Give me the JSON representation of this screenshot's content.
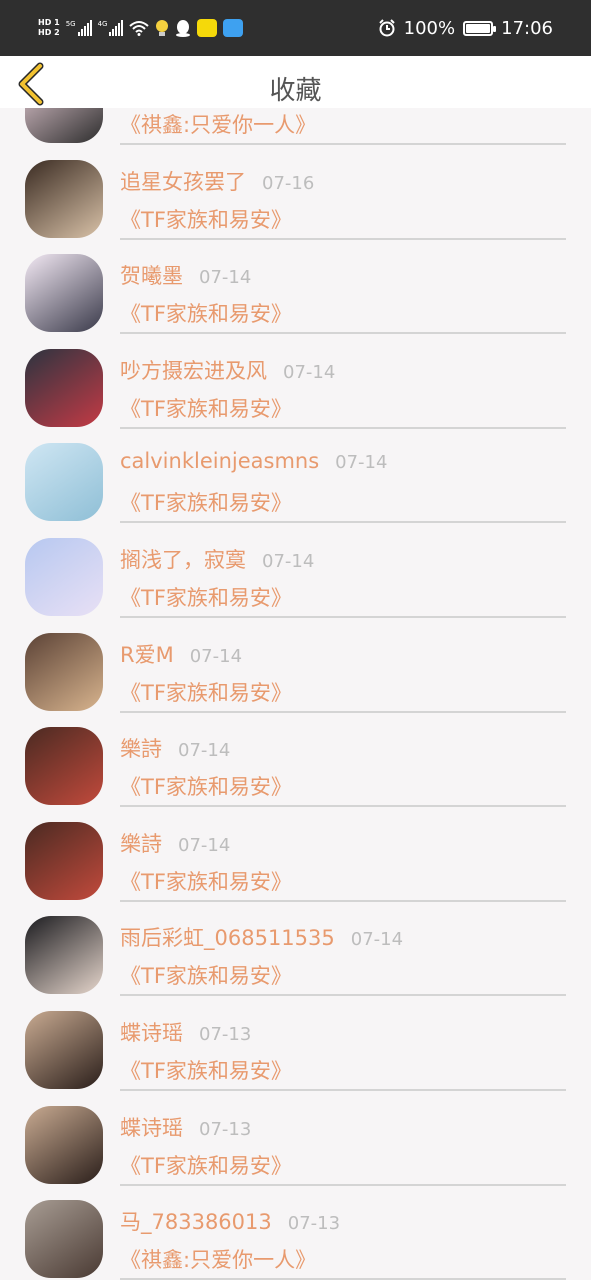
{
  "status_bar": {
    "hd1": "HD 1",
    "hd2": "HD 2",
    "sig1_tag": "5G",
    "sig2_tag": "4G",
    "battery": "100%",
    "time": "17:06"
  },
  "header": {
    "title": "收藏"
  },
  "colors": {
    "accent": "#e89a6e",
    "muted": "#bdbdbd",
    "status_bar": "#2f2f2f",
    "back": "#f2c230"
  },
  "items": [
    {
      "name": "",
      "date": "",
      "group": "《祺鑫:只爱你一人》",
      "avatar": [
        "#f1d6df",
        "#2d2d2d"
      ]
    },
    {
      "name": "追星女孩罢了",
      "date": "07-16",
      "group": "《TF家族和易安》",
      "avatar": [
        "#3a2b22",
        "#d9c2a8"
      ]
    },
    {
      "name": "贺曦墨",
      "date": "07-14",
      "group": "《TF家族和易安》",
      "avatar": [
        "#f3e9f4",
        "#3a3a4a"
      ]
    },
    {
      "name": "吵方摄宏进及风",
      "date": "07-14",
      "group": "《TF家族和易安》",
      "avatar": [
        "#2c3440",
        "#c43a45"
      ]
    },
    {
      "name": "calvinkleinjeasmns",
      "date": "07-14",
      "group": "《TF家族和易安》",
      "avatar": [
        "#cfe6f3",
        "#8fbfd6"
      ]
    },
    {
      "name": "搁浅了，寂寞",
      "date": "07-14",
      "group": "《TF家族和易安》",
      "avatar": [
        "#b7c8f0",
        "#e8e0f5"
      ]
    },
    {
      "name": "R爱M",
      "date": "07-14",
      "group": "《TF家族和易安》",
      "avatar": [
        "#5b4236",
        "#d8b48e"
      ]
    },
    {
      "name": "樂詩",
      "date": "07-14",
      "group": "《TF家族和易安》",
      "avatar": [
        "#4a2a22",
        "#c24a3c"
      ]
    },
    {
      "name": "樂詩",
      "date": "07-14",
      "group": "《TF家族和易安》",
      "avatar": [
        "#4a2a22",
        "#c24a3c"
      ]
    },
    {
      "name": "雨后彩虹_068511535",
      "date": "07-14",
      "group": "《TF家族和易安》",
      "avatar": [
        "#1b1b1f",
        "#e6d6cc"
      ]
    },
    {
      "name": "蝶诗瑶",
      "date": "07-13",
      "group": "《TF家族和易安》",
      "avatar": [
        "#c9ab92",
        "#2a1e1a"
      ]
    },
    {
      "name": "蝶诗瑶",
      "date": "07-13",
      "group": "《TF家族和易安》",
      "avatar": [
        "#c9ab92",
        "#2a1e1a"
      ]
    },
    {
      "name": "马_783386013",
      "date": "07-13",
      "group": "《祺鑫:只爱你一人》",
      "avatar": [
        "#a89d94",
        "#4a3a33"
      ]
    }
  ]
}
